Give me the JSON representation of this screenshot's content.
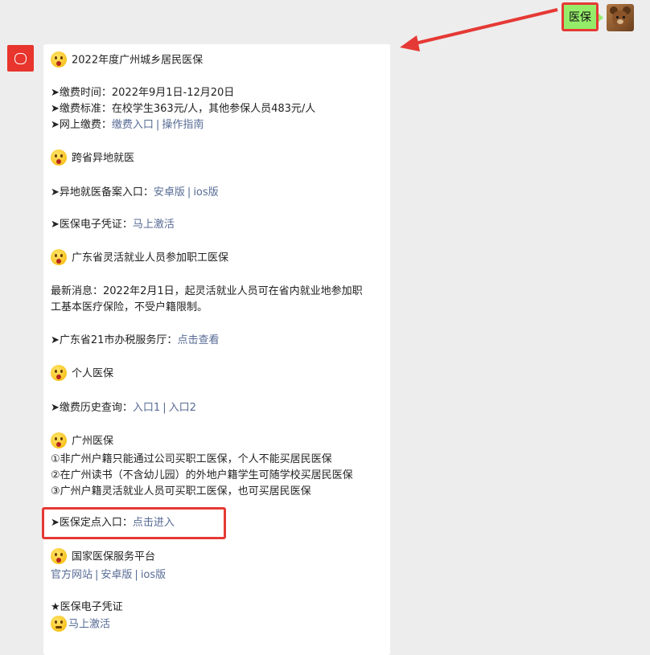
{
  "user": {
    "message": "医保"
  },
  "sections": {
    "s1_title": "2022年度广州城乡居民医保",
    "s1_time": "➤缴费时间：2022年9月1日-12月20日",
    "s1_standard": "➤缴费标准：在校学生363元/人，其他参保人员483元/人",
    "s1_online_label": "➤网上缴费：",
    "s1_online_link1": "缴费入口",
    "s1_online_sep": "|",
    "s1_online_link2": "操作指南",
    "s2_title": "跨省异地就医",
    "s2_record_label": "➤异地就医备案入口：",
    "s2_link_android": "安卓版",
    "s2_sep": "|",
    "s2_link_ios": "ios版",
    "s3_label": "➤医保电子凭证：",
    "s3_link": "马上激活",
    "s4_title": "广东省灵活就业人员参加职工医保",
    "s4_news_1": "最新消息：2022年2月1日，起灵活就业人员可在省内就业地参加职",
    "s4_news_2": "工基本医疗保险，不受户籍限制。",
    "s4_tax_label": "➤广东省21市办税服务厅：",
    "s4_tax_link": "点击查看",
    "s5_title": "个人医保",
    "s5_history_label": "➤缴费历史查询：",
    "s5_link1": "入口1",
    "s5_sep": "|",
    "s5_link2": "入口2",
    "s6_title": "广州医保",
    "s6_item1": "①非广州户籍只能通过公司买职工医保，个人不能买居民医保",
    "s6_item2": "②在广州读书（不含幼儿园）的外地户籍学生可随学校买居民医保",
    "s6_item3": "③广州户籍灵活就业人员可买职工医保，也可买居民医保",
    "s7_label": "➤医保定点入口：",
    "s7_link": "点击进入",
    "s8_title": "国家医保服务平台",
    "s8_link_web": "官方网站",
    "s8_sep1": "|",
    "s8_link_android": "安卓版",
    "s8_sep2": "|",
    "s8_link_ios": "ios版",
    "s9_title": "★医保电子凭证",
    "s9_link": "马上激活"
  },
  "colors": {
    "user_bubble": "#95ec69",
    "highlight": "#e53935",
    "link": "#576b95",
    "background": "#ededed"
  }
}
